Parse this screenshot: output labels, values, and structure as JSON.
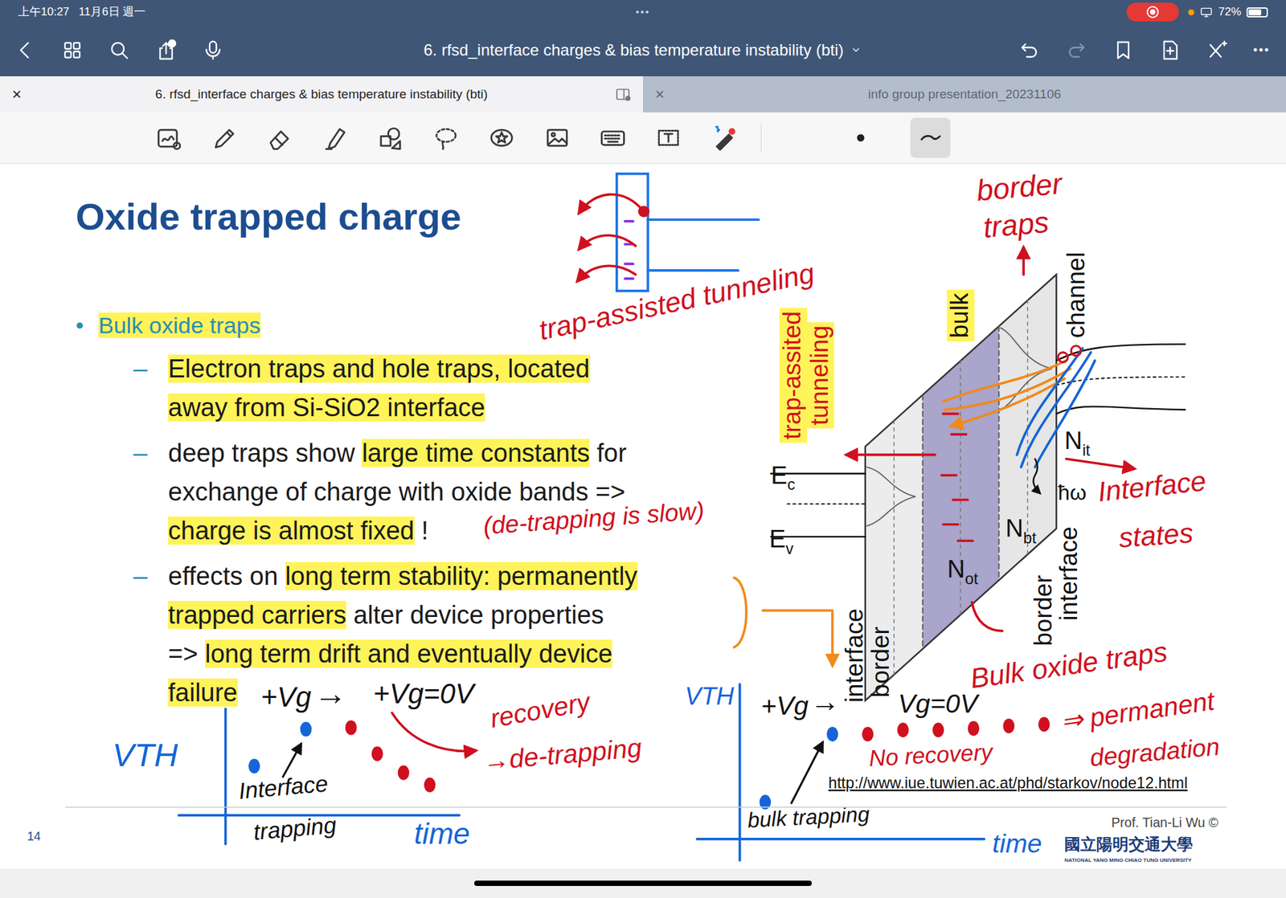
{
  "status_bar": {
    "time": "上午10:27",
    "date": "11月6日 週一",
    "center": "•••",
    "recording": true,
    "battery": "72%",
    "battery_level": 0.72
  },
  "toolbar": {
    "title": "6. rfsd_interface charges & bias temperature instability (bti)",
    "more": "•••",
    "redo_disabled": true
  },
  "tabs": [
    {
      "close": "×",
      "label": "6. rfsd_interface charges & bias temperature instability (bti)",
      "selected": true
    },
    {
      "close": "×",
      "label": "info group presentation_20231106",
      "selected": false
    }
  ],
  "tools": [
    {
      "selected": false
    },
    {
      "selected": false
    },
    {
      "selected": false
    },
    {
      "selected": false
    },
    {
      "selected": false
    },
    {
      "selected": false
    },
    {
      "selected": false
    },
    {
      "selected": false
    },
    {
      "selected": false
    },
    {
      "selected": false
    },
    {
      "selected": false
    }
  ],
  "pen_sizes": [
    {
      "selected": false
    },
    {
      "selected": true
    }
  ],
  "slide": {
    "title": "Oxide trapped charge",
    "bullet": {
      "marker": "•",
      "segments": [
        {
          "text": "Bulk oxide traps",
          "highlighted": true
        }
      ]
    },
    "items": [
      {
        "marker": "–",
        "lines": [
          [
            {
              "text": "Electron traps and hole traps, located",
              "highlighted": true
            }
          ],
          [
            {
              "text": "away from Si-SiO2 interface",
              "highlighted": true
            }
          ]
        ]
      },
      {
        "marker": "–",
        "lines": [
          [
            {
              "text": "deep traps show ",
              "highlighted": false
            },
            {
              "text": "large time constants",
              "highlighted": true
            },
            {
              "text": " for",
              "highlighted": false
            }
          ],
          [
            {
              "text": "exchange of charge with oxide bands =>",
              "highlighted": false
            }
          ],
          [
            {
              "text": "charge is almost fixed",
              "highlighted": true
            },
            {
              "text": " !",
              "highlighted": false
            }
          ]
        ]
      },
      {
        "marker": "–",
        "lines": [
          [
            {
              "text": "effects on ",
              "highlighted": false
            },
            {
              "text": "long term stability: permanently",
              "highlighted": true
            }
          ],
          [
            {
              "text": "trapped carriers",
              "highlighted": true
            },
            {
              "text": " alter device properties",
              "highlighted": false
            }
          ],
          [
            {
              "text": "=> ",
              "highlighted": false
            },
            {
              "text": "long term drift and eventually device",
              "highlighted": true
            }
          ],
          [
            {
              "text": "failure",
              "highlighted": true
            }
          ]
        ]
      }
    ],
    "page_number": "14",
    "url": "http://www.iue.tuwien.ac.at/phd/starkov/node12.html",
    "author": "Prof. Tian-Li Wu ©",
    "university": "國立陽明交通大學",
    "university_en": "NATIONAL YANG MING CHIAO TUNG UNIVERSITY"
  },
  "diagram": {
    "ec": {
      "main": "E",
      "sub": "c"
    },
    "ev": {
      "main": "E",
      "sub": "v"
    },
    "tat": {
      "lines": [
        "trap-assited",
        "tunneling"
      ],
      "highlighted": true
    },
    "bulk": {
      "text": "bulk",
      "highlighted": true
    },
    "channel": "channel",
    "n_ot": {
      "main": "N",
      "sub": "ot"
    },
    "n_bt": {
      "main": "N",
      "sub": "bt"
    },
    "n_it": {
      "main": "N",
      "sub": "it"
    },
    "phonon": "ħω",
    "left_labels": [
      "interface",
      "border"
    ],
    "right_labels": [
      "border",
      "interface"
    ]
  },
  "sketches": [
    {
      "y_label": "VTH",
      "x_label": "time",
      "stress": "+Vg",
      "arrow": "→",
      "relax": "+Vg=0V",
      "stress_points": [
        60,
        105
      ],
      "relax_points": [
        107,
        75,
        52,
        37
      ],
      "stress_color": "#1565d8",
      "relax_color": "#d0101e"
    },
    {
      "y_label": "VTH",
      "x_label": "time",
      "stress": "+Vg",
      "arrow": "→",
      "relax": "Vg=0V",
      "stress_points": [
        45,
        128
      ],
      "relax_points": [
        128,
        133,
        133,
        135,
        138,
        140
      ],
      "stress_color": "#1565d8",
      "relax_color": "#d0101e"
    }
  ],
  "annotations": [
    {
      "text": "trap-assisted tunneling",
      "color": "#d0101e"
    },
    {
      "text": "border",
      "color": "#d0101e"
    },
    {
      "text": "traps",
      "color": "#d0101e"
    },
    {
      "text": "Interface",
      "color": "#d0101e"
    },
    {
      "text": "states",
      "color": "#d0101e"
    },
    {
      "text": "(de-trapping is slow)",
      "color": "#d0101e"
    },
    {
      "text": "Bulk oxide traps",
      "color": "#d0101e"
    },
    {
      "text": "⇒ permanent",
      "color": "#d0101e"
    },
    {
      "text": "degradation",
      "color": "#d0101e"
    },
    {
      "text": "No recovery",
      "color": "#d0101e"
    },
    {
      "text": "recovery",
      "color": "#d0101e"
    },
    {
      "text": "→de-trapping",
      "color": "#d0101e"
    },
    {
      "text": "Interface",
      "color": "#111111"
    },
    {
      "text": "trapping",
      "color": "#111111"
    },
    {
      "text": "bulk trapping",
      "color": "#111111"
    }
  ]
}
